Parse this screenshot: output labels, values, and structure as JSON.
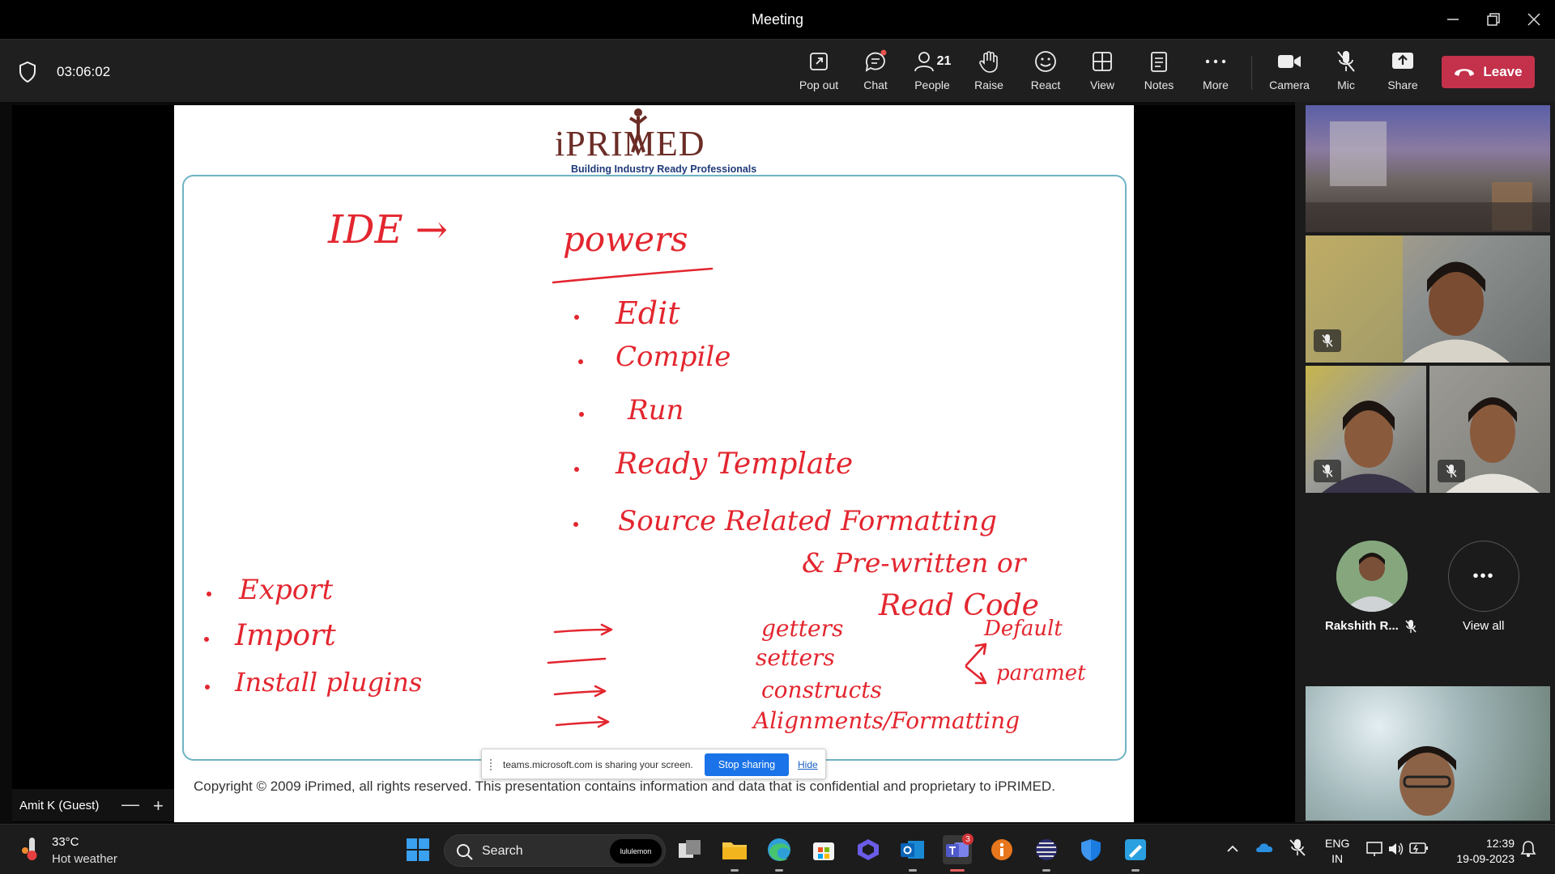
{
  "window": {
    "title": "Meeting"
  },
  "toolbar": {
    "timer": "03:06:02",
    "buttons": {
      "popout": "Pop out",
      "chat": "Chat",
      "people": "People",
      "people_count": "21",
      "raise": "Raise",
      "react": "React",
      "view": "View",
      "notes": "Notes",
      "more": "More",
      "camera": "Camera",
      "mic": "Mic",
      "share": "Share"
    },
    "leave_label": "Leave"
  },
  "slide": {
    "logo_text": "iPRIMED",
    "logo_tagline": "Building Industry Ready Professionals",
    "handwriting": {
      "heading_left": "IDE →",
      "heading_right": "powers",
      "items": [
        "Edit",
        "Compile",
        "Run",
        "Ready Template",
        "Source Related Formatting",
        "& Pre-written or",
        "Read Code"
      ],
      "left_items": [
        "Export",
        "Import",
        "Install plugins"
      ],
      "arrow_items": [
        "getters",
        "setters",
        "constructs",
        "Alignments/Formatting"
      ],
      "constructor_branches": [
        "Default",
        "paramet"
      ]
    },
    "copyright": "Copyright © 2009 iPrimed, all rights reserved. This presentation contains information  and data  that is confidential and proprietary to iPRIMED."
  },
  "sharebar": {
    "message": "teams.microsoft.com is sharing your screen.",
    "stop_label": "Stop sharing",
    "hide_label": "Hide"
  },
  "stage": {
    "presenter_name": "Amit K (Guest)",
    "zoom_out": "—",
    "zoom_in": "+"
  },
  "participants": {
    "named_participant": "Rakshith R...",
    "view_all_label": "View all",
    "view_all_icon": "•••"
  },
  "taskbar": {
    "weather_temp": "33°C",
    "weather_desc": "Hot weather",
    "search_label": "Search",
    "search_pill": "lululemon",
    "teams_badge": "3",
    "lang_line1": "ENG",
    "lang_line2": "IN",
    "time": "12:39",
    "date": "19-09-2023"
  },
  "colors": {
    "leave": "#c4314b",
    "stop_sharing": "#1a73e8",
    "ink": "#e3262f",
    "board_border": "#6fb3c3"
  }
}
